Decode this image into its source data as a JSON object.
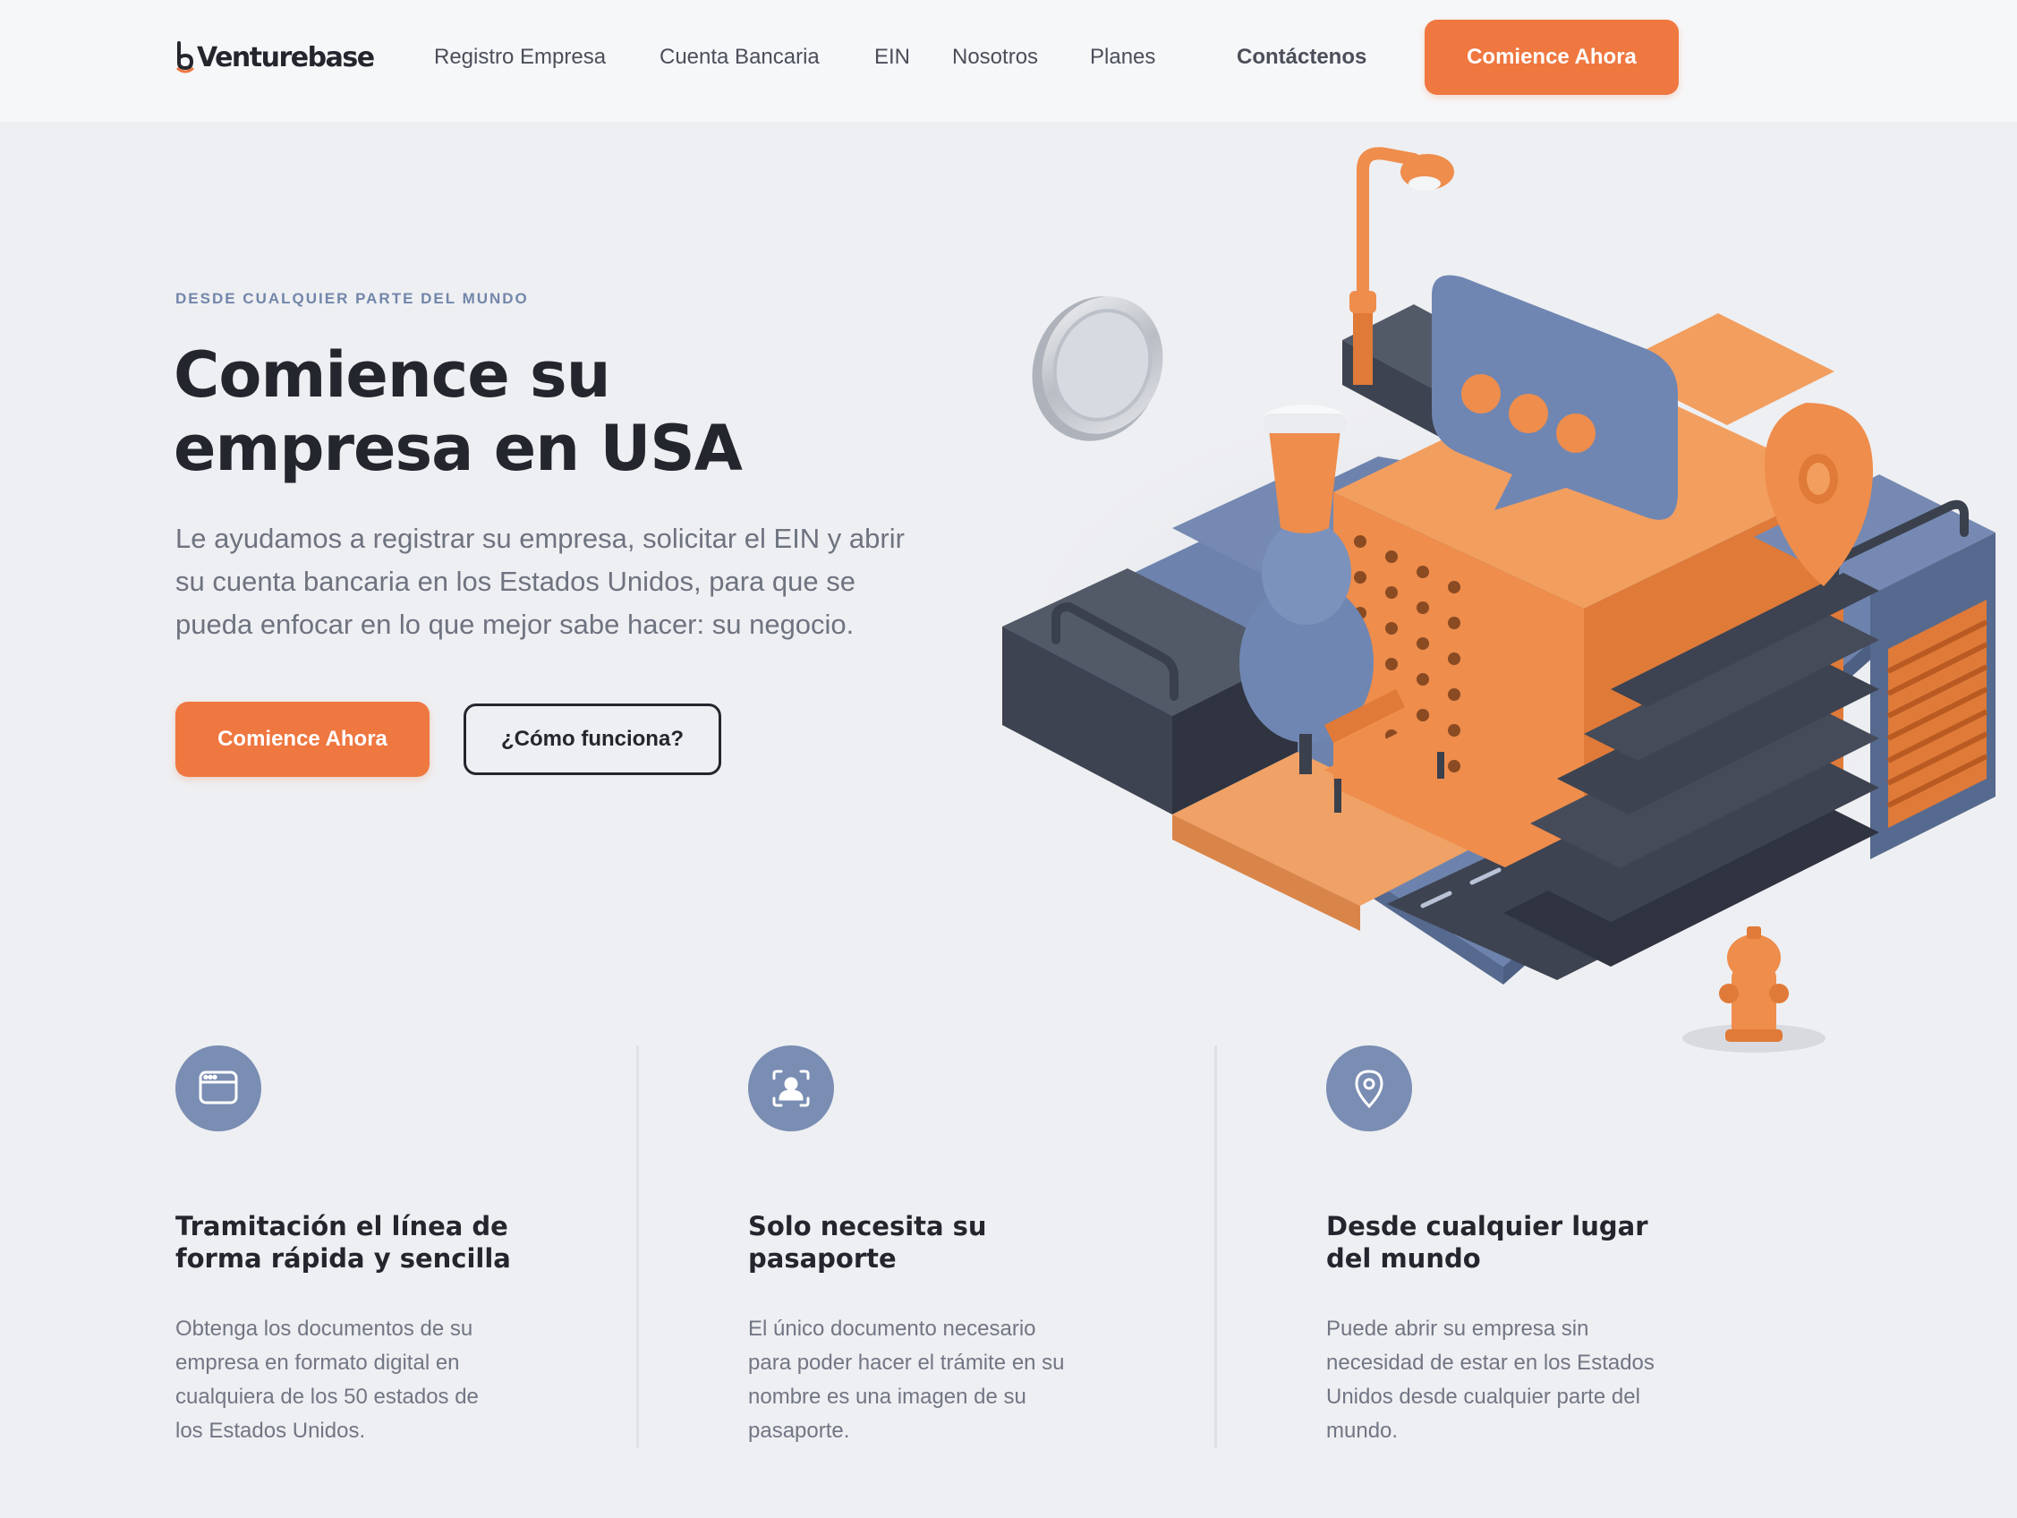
{
  "header": {
    "logo_text": "Venturebase",
    "nav": [
      {
        "label": "Registro Empresa"
      },
      {
        "label": "Cuenta Bancaria"
      },
      {
        "label": "EIN"
      },
      {
        "label": "Nosotros"
      },
      {
        "label": "Planes"
      }
    ],
    "contact_label": "Contáctenos",
    "cta_label": "Comience Ahora"
  },
  "hero": {
    "eyebrow": "DESDE CUALQUIER PARTE DEL MUNDO",
    "title_line1": "Comience su",
    "title_line2": "empresa en USA",
    "description": "Le ayudamos a registrar su empresa, solicitar el EIN y abrir su cuenta bancaria en los Estados Unidos, para que se pueda enfocar en lo que mejor sabe hacer: su negocio.",
    "cta_primary": "Comience Ahora",
    "cta_secondary": "¿Cómo funciona?"
  },
  "features": [
    {
      "icon": "browser-window-icon",
      "title": "Tramitación el línea de forma rápida y sencilla",
      "text": "Obtenga los documentos de su empresa en formato digital en cualquiera de los 50 estados de los Estados Unidos."
    },
    {
      "icon": "user-scan-icon",
      "title": "Solo necesita su pasaporte",
      "text": "El único documento necesario para poder hacer el trámite en su nombre es una imagen de su pasaporte."
    },
    {
      "icon": "map-pin-icon",
      "title": "Desde cualquier lugar del mundo",
      "text": "Puede abrir su empresa sin necesidad de estar en los Estados Unidos desde cualquier parte del mundo."
    }
  ],
  "colors": {
    "accent": "#ef7740",
    "icon_bg": "#7a8db3",
    "eyebrow": "#7286ab",
    "background": "#eeeff2",
    "dark_blocks": "#3d4350",
    "blue_blocks": "#6d83ad"
  }
}
